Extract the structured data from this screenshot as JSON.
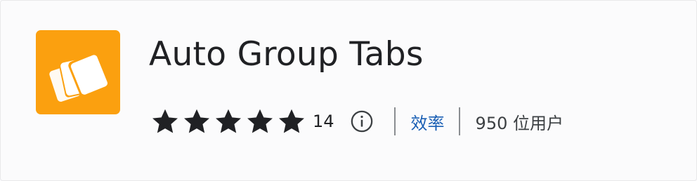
{
  "extension": {
    "title": "Auto Group Tabs",
    "icon": "stacked-cards-icon",
    "icon_color": "#fba00f",
    "rating": 5,
    "rating_max": 5,
    "rating_count": "14",
    "category": "效率",
    "users": "950 位用户"
  },
  "colors": {
    "star": "#202124",
    "link": "#1a5fb4",
    "text": "#202124",
    "divider": "#8a8d91"
  }
}
